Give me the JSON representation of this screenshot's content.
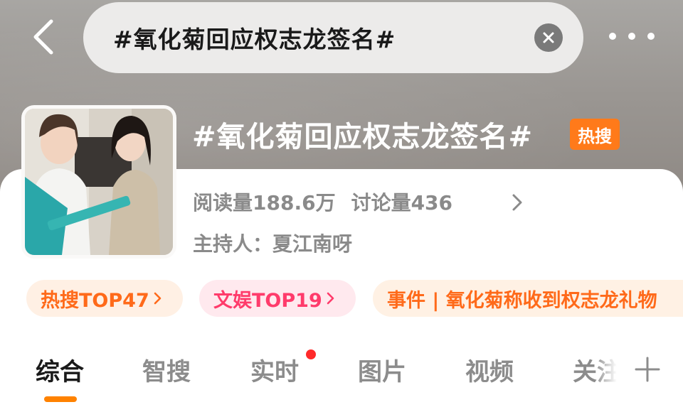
{
  "search": {
    "query": "#氧化菊回应权志龙签名#"
  },
  "topic": {
    "title": "#氧化菊回应权志龙签名#",
    "badge": "热搜",
    "reads": "阅读量188.6万",
    "discussions": "讨论量436",
    "host": "主持人：夏江南呀"
  },
  "chips": {
    "hot": "热搜TOP47",
    "ent": "文娱TOP19",
    "event": "事件 | 氧化菊称收到权志龙礼物"
  },
  "tabs": [
    "综合",
    "智搜",
    "实时",
    "图片",
    "视频",
    "关注"
  ],
  "colors": {
    "accent": "#ff8200",
    "hot_badge": "#ff7a1a",
    "ent_chip": "#ff3b6b",
    "notify_dot": "#ff2a2a"
  },
  "icons": {
    "back": "chevron-left-icon",
    "clear": "close-icon",
    "more": "more-dots-icon",
    "add": "plus-icon"
  }
}
